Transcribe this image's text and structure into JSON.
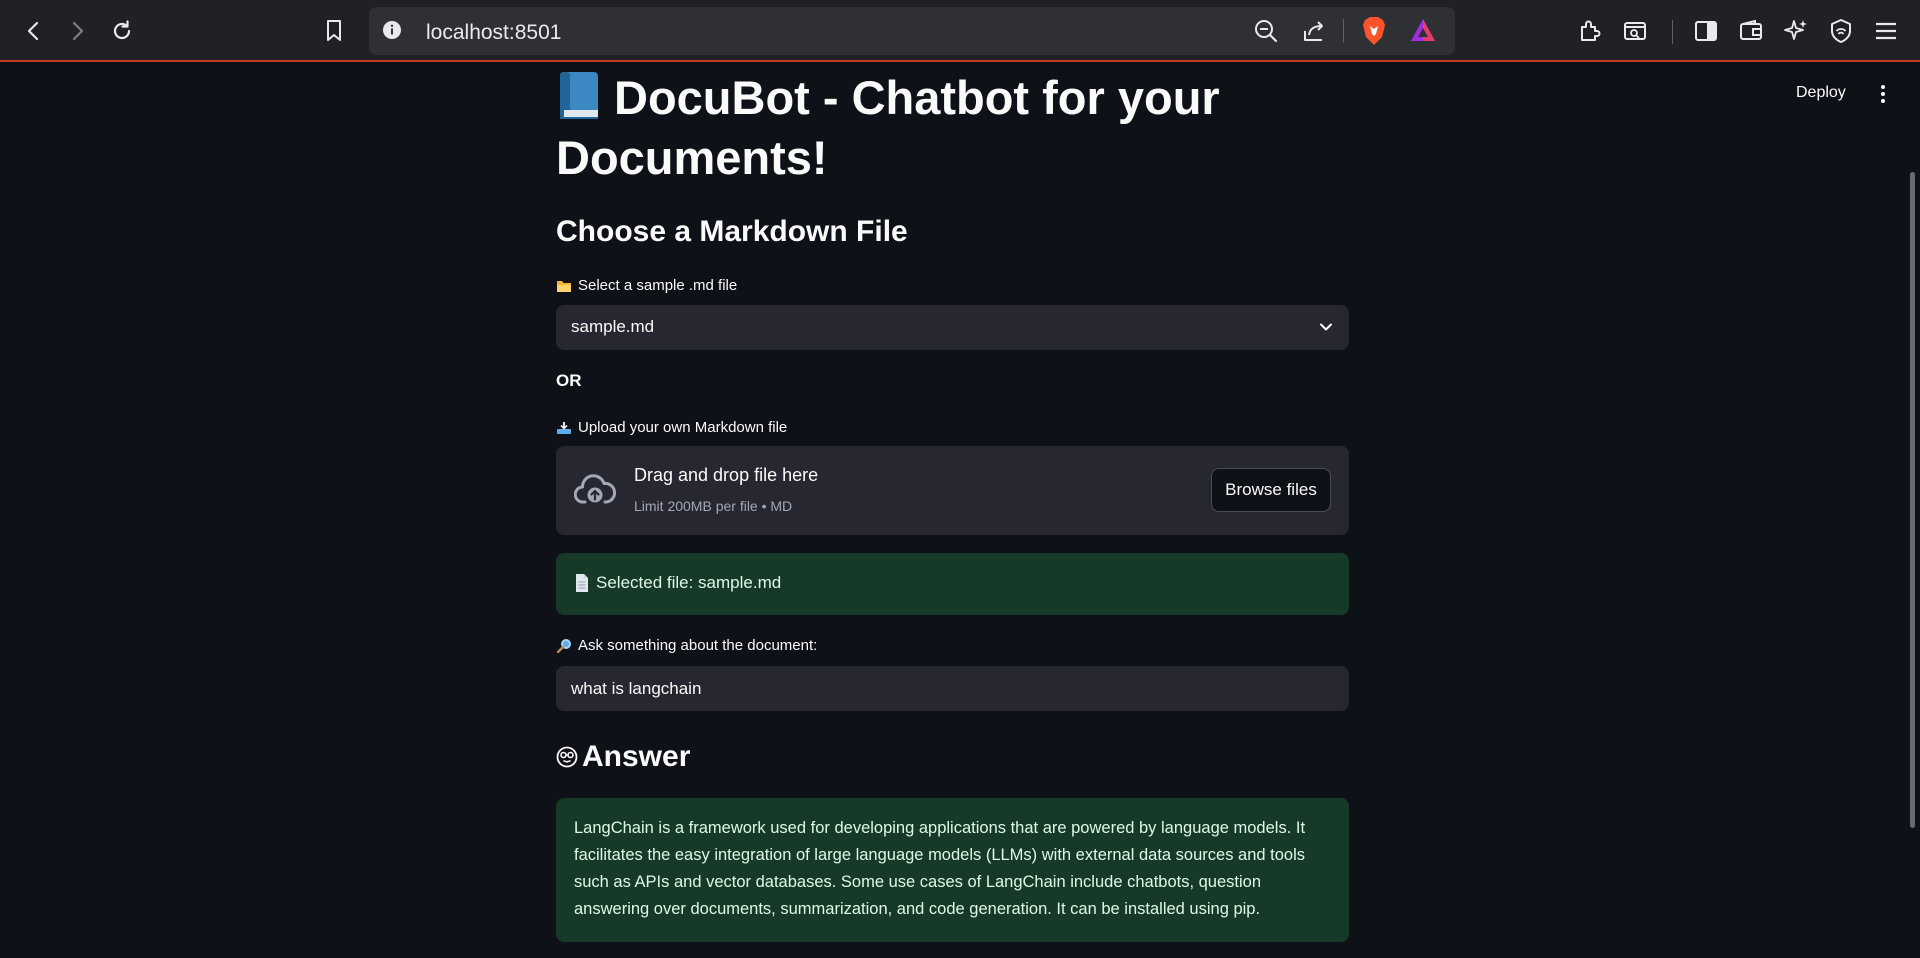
{
  "browser": {
    "url": "localhost:8501"
  },
  "app": {
    "deploy_label": "Deploy",
    "title": "DocuBot - Chatbot for your Documents!",
    "section_heading": "Choose a Markdown File",
    "sample_select": {
      "label": "Select a sample .md file",
      "value": "sample.md"
    },
    "or_text": "OR",
    "uploader": {
      "label": "Upload your own Markdown file",
      "drag_text": "Drag and drop file here",
      "limit_text": "Limit 200MB per file • MD",
      "browse_label": "Browse files"
    },
    "selected_file_text": "Selected file: sample.md",
    "question": {
      "label": "Ask something about the document:",
      "value": "what is langchain"
    },
    "answer_heading": "Answer",
    "answer_text": "LangChain is a framework used for developing applications that are powered by language models. It facilitates the easy integration of large language models (LLMs) with external data sources and tools such as APIs and vector databases. Some use cases of LangChain include chatbots, question answering over documents, summarization, and code generation. It can be installed using pip."
  },
  "colors": {
    "background": "#0e1117",
    "widget": "#262730",
    "success_bg": "#173928",
    "success_text": "#dff8e6",
    "chrome": "#202124"
  }
}
